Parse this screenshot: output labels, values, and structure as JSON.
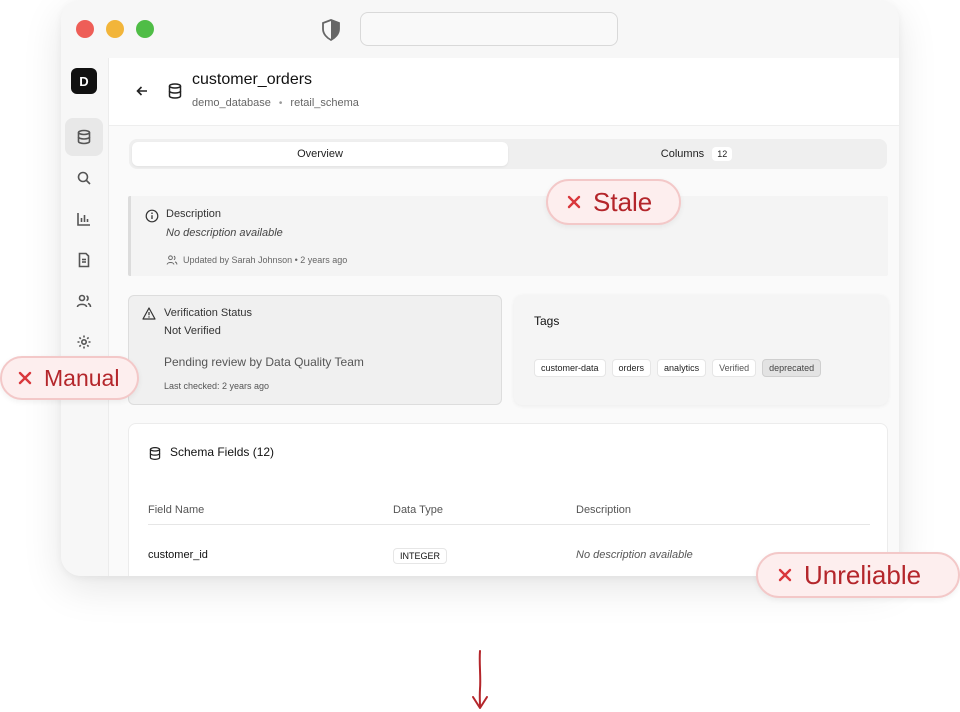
{
  "header": {
    "title": "customer_orders",
    "breadcrumb": {
      "database": "demo_database",
      "separator": "•",
      "schema": "retail_schema"
    }
  },
  "sidebar": {
    "logo": "D",
    "items": [
      "database-icon",
      "search-icon",
      "chart-icon",
      "document-icon",
      "users-icon",
      "gear-icon"
    ]
  },
  "tabs": {
    "overview": "Overview",
    "columns": "Columns",
    "columns_count": "12"
  },
  "description": {
    "label": "Description",
    "text": "No description available",
    "updated": "Updated by Sarah Johnson • 2 years ago"
  },
  "verification": {
    "label": "Verification Status",
    "value": "Not Verified",
    "pending": "Pending review by Data Quality Team",
    "last_checked": "Last checked: 2 years ago"
  },
  "tags": {
    "title": "Tags",
    "items": [
      "customer-data",
      "orders",
      "analytics",
      "Verified",
      "deprecated"
    ]
  },
  "schema": {
    "title": "Schema Fields (12)",
    "columns": [
      "Field Name",
      "Data Type",
      "Description"
    ],
    "rows": [
      {
        "name": "customer_id",
        "type": "INTEGER",
        "description": "No description available"
      }
    ]
  },
  "badges": {
    "stale": "Stale",
    "manual": "Manual",
    "unreliable": "Unreliable"
  },
  "colors": {
    "badge_text": "#b4262b",
    "badge_bg": "#fdeeee",
    "badge_border": "#f3c8c8"
  }
}
